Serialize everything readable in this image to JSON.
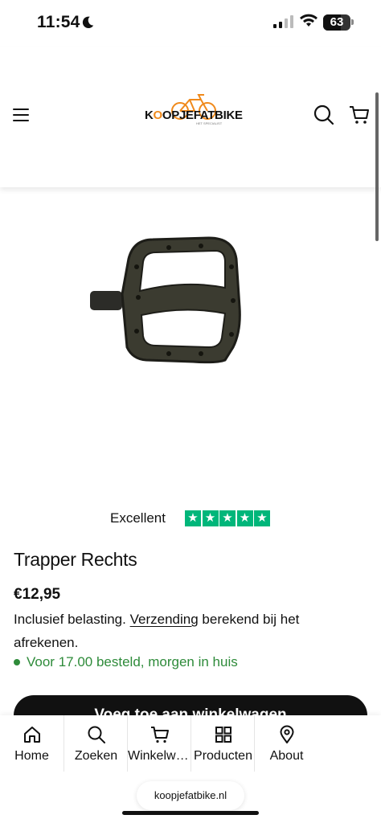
{
  "status_bar": {
    "time": "11:54",
    "battery": "63"
  },
  "header": {
    "logo": {
      "text_before": "K",
      "text_o": "O",
      "text_after": "OPJEFATBIKE",
      "tagline": "HET SPECIALIST"
    }
  },
  "rating": {
    "label": "Excellent",
    "stars": 5,
    "star_color": "#00b67a"
  },
  "product": {
    "title": "Trapper Rechts",
    "price": "€12,95",
    "tax_prefix": "Inclusief belasting.",
    "shipping_link": "Verzending",
    "tax_suffix": "berekend bij het afrekenen.",
    "stock": "Voor 17.00 besteld, morgen in huis",
    "add_to_cart": "Voeg toe aan winkelwagen"
  },
  "bottom_nav": {
    "items": [
      {
        "label": "Home",
        "icon": "home-icon"
      },
      {
        "label": "Zoeken",
        "icon": "search-icon"
      },
      {
        "label": "Winkelwagen",
        "icon": "cart-icon"
      },
      {
        "label": "Producten",
        "icon": "grid-icon"
      },
      {
        "label": "About",
        "icon": "location-pin-icon"
      }
    ]
  },
  "browser": {
    "url": "koopjefatbike.nl"
  },
  "colors": {
    "accent": "#f08a1c",
    "stock_green": "#2e8b3a",
    "trustpilot": "#00b67a"
  }
}
